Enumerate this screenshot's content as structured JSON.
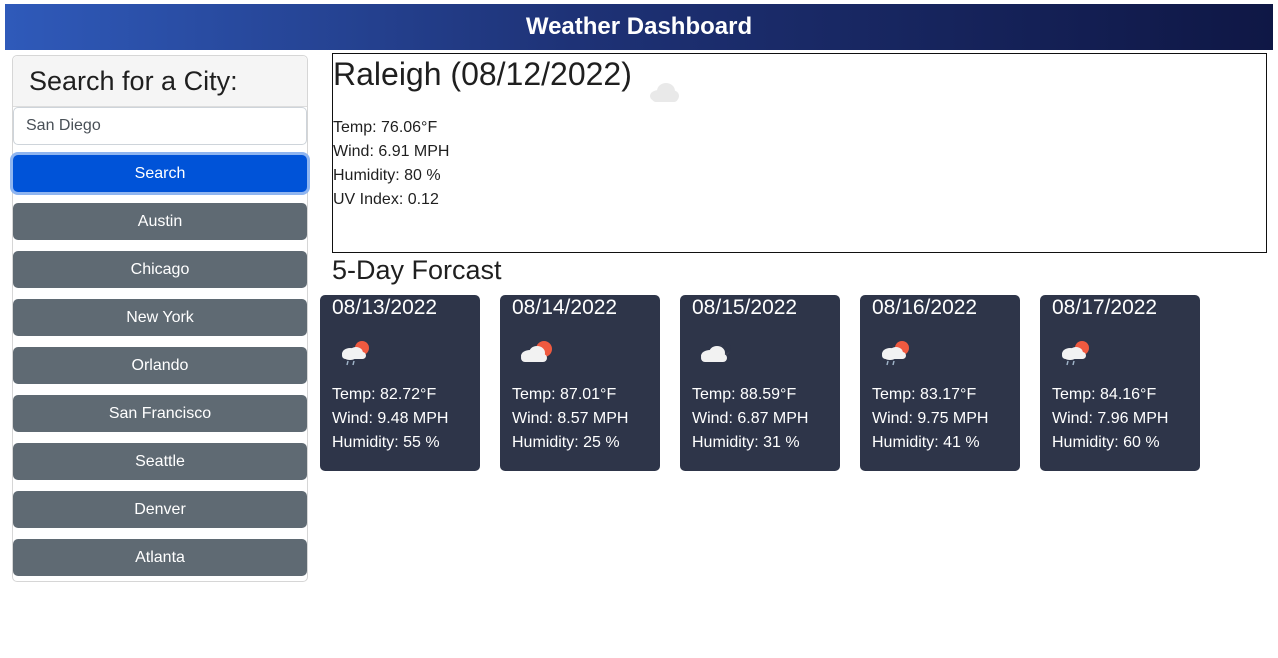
{
  "header": {
    "title": "Weather Dashboard"
  },
  "sidebar": {
    "heading": "Search for a City:",
    "search_value": "San Diego",
    "search_button": "Search",
    "cities": [
      "Austin",
      "Chicago",
      "New York",
      "Orlando",
      "San Francisco",
      "Seattle",
      "Denver",
      "Atlanta"
    ]
  },
  "current": {
    "title": "Raleigh (08/12/2022)",
    "icon": "cloud-icon",
    "temp": "Temp: 76.06°F",
    "wind": "Wind: 6.91 MPH",
    "humidity": "Humidity: 80 %",
    "uv": "UV Index: 0.12"
  },
  "forecast": {
    "title": "5-Day Forcast",
    "days": [
      {
        "date": "08/13/2022",
        "icon": "rain-sun-icon",
        "temp": "Temp: 82.72°F",
        "wind": "Wind: 9.48 MPH",
        "humidity": "Humidity: 55 %"
      },
      {
        "date": "08/14/2022",
        "icon": "partly-cloudy-icon",
        "temp": "Temp: 87.01°F",
        "wind": "Wind: 8.57 MPH",
        "humidity": "Humidity: 25 %"
      },
      {
        "date": "08/15/2022",
        "icon": "night-cloud-icon",
        "temp": "Temp: 88.59°F",
        "wind": "Wind: 6.87 MPH",
        "humidity": "Humidity: 31 %"
      },
      {
        "date": "08/16/2022",
        "icon": "rain-sun-icon",
        "temp": "Temp: 83.17°F",
        "wind": "Wind: 9.75 MPH",
        "humidity": "Humidity: 41 %"
      },
      {
        "date": "08/17/2022",
        "icon": "rain-sun-icon",
        "temp": "Temp: 84.16°F",
        "wind": "Wind: 7.96 MPH",
        "humidity": "Humidity: 60 %"
      }
    ]
  }
}
